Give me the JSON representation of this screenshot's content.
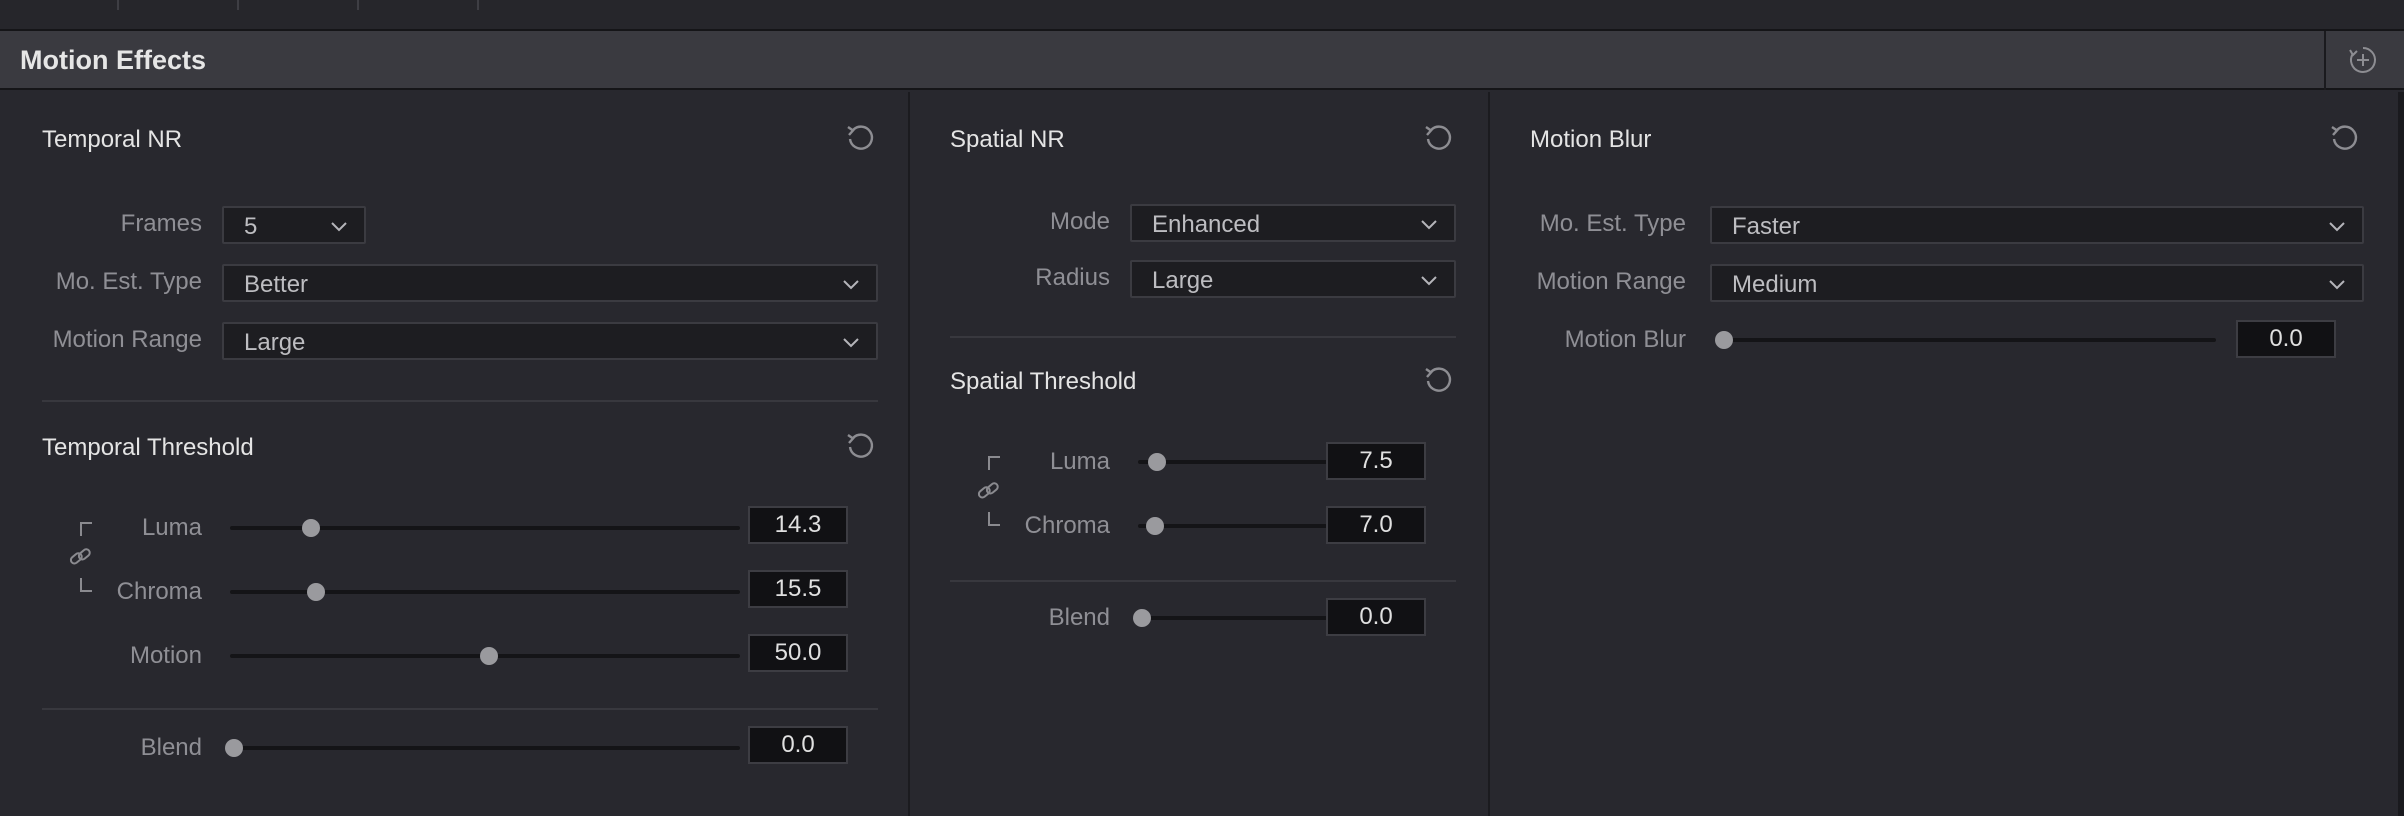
{
  "panel": {
    "title": "Motion Effects"
  },
  "temporal_nr": {
    "title": "Temporal NR",
    "frames": {
      "label": "Frames",
      "value": "5"
    },
    "mo_est_type": {
      "label": "Mo. Est. Type",
      "value": "Better"
    },
    "motion_range": {
      "label": "Motion Range",
      "value": "Large"
    }
  },
  "temporal_threshold": {
    "title": "Temporal Threshold",
    "luma": {
      "label": "Luma",
      "value": "14.3",
      "level": 0.15
    },
    "chroma": {
      "label": "Chroma",
      "value": "15.5",
      "level": 0.16
    },
    "motion": {
      "label": "Motion",
      "value": "50.0",
      "level": 0.5
    },
    "blend": {
      "label": "Blend",
      "value": "0.0",
      "level": 0.0
    }
  },
  "spatial_nr": {
    "title": "Spatial NR",
    "mode": {
      "label": "Mode",
      "value": "Enhanced"
    },
    "radius": {
      "label": "Radius",
      "value": "Large"
    }
  },
  "spatial_threshold": {
    "title": "Spatial Threshold",
    "luma": {
      "label": "Luma",
      "value": "7.5",
      "level": 0.08
    },
    "chroma": {
      "label": "Chroma",
      "value": "7.0",
      "level": 0.07
    },
    "blend": {
      "label": "Blend",
      "value": "0.0",
      "level": 0.0
    }
  },
  "motion_blur": {
    "title": "Motion Blur",
    "mo_est_type": {
      "label": "Mo. Est. Type",
      "value": "Faster"
    },
    "motion_range": {
      "label": "Motion Range",
      "value": "Medium"
    },
    "motion_blur": {
      "label": "Motion Blur",
      "value": "0.0",
      "level": 0.0
    }
  },
  "icons": {
    "reset": "reset-icon",
    "add": "add-node-icon",
    "link": "link-icon",
    "dropdown": "chevron-down-icon"
  }
}
